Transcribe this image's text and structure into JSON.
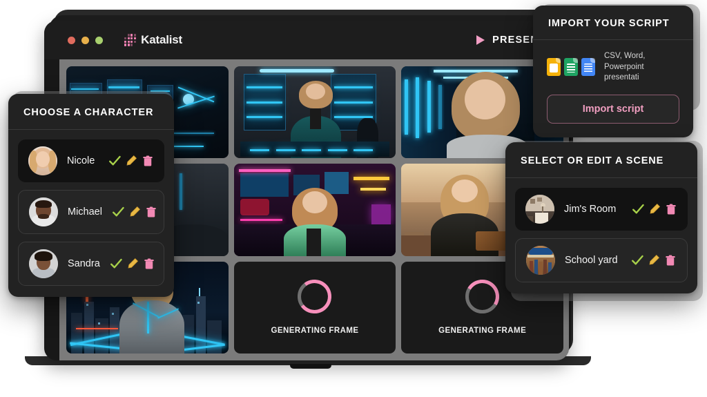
{
  "app": {
    "brand_name": "Katalist",
    "logo_icon": "katalist-dot-logo",
    "window_dots": [
      "#e06c5e",
      "#e8b04b",
      "#a8d06e"
    ],
    "present_label": "PRESENT",
    "present_icon": "play-triangle-icon"
  },
  "accent": {
    "pink": "#f29ec4",
    "pink_strong": "#f78fbb",
    "green_check": "#a8d14a",
    "yellow_pencil": "#e8b845",
    "trash_pink": "#f289b4",
    "panel_bg": "#222222",
    "row_selected_bg": "#121212",
    "screen_bg": "#7b7b7b"
  },
  "storyboard": {
    "cells": [
      {
        "id": "frame-1",
        "type": "image",
        "alt": "Tech lab with blue servers"
      },
      {
        "id": "frame-2",
        "type": "image",
        "alt": "Woman in teal suit at glowing store counter"
      },
      {
        "id": "frame-3",
        "type": "image",
        "alt": "Woman close-up in blue server corridor"
      },
      {
        "id": "frame-4",
        "type": "image",
        "alt": "Woman in dark suit side view"
      },
      {
        "id": "frame-5",
        "type": "image",
        "alt": "Woman in green jacket in neon club"
      },
      {
        "id": "frame-6",
        "type": "image",
        "alt": "Woman holding box over city rooftops at sunset"
      },
      {
        "id": "frame-7",
        "type": "image",
        "alt": "Woman in grey suit over neon night skyline"
      },
      {
        "id": "frame-8",
        "type": "generating",
        "label": "GENERATING FRAME"
      },
      {
        "id": "frame-9",
        "type": "generating",
        "label": "GENERATING FRAME"
      }
    ]
  },
  "import_panel": {
    "title": "IMPORT  YOUR SCRIPT",
    "formats_text": "CSV, Word, Powerpoint presentati",
    "file_icons": [
      {
        "name": "google-slides-icon",
        "color": "#f5b20a"
      },
      {
        "name": "google-sheets-icon",
        "color": "#1fa463"
      },
      {
        "name": "google-docs-icon",
        "color": "#4286f5"
      }
    ],
    "button_label": "Import script"
  },
  "character_panel": {
    "title": "CHOOSE A CHARACTER",
    "items": [
      {
        "label": "Nicole",
        "selected": true,
        "avatar": "avatar-nicole"
      },
      {
        "label": "Michael",
        "selected": false,
        "avatar": "avatar-michael"
      },
      {
        "label": "Sandra",
        "selected": false,
        "avatar": "avatar-sandra"
      }
    ],
    "actions": [
      "check-icon",
      "pencil-icon",
      "trash-icon"
    ]
  },
  "scene_panel": {
    "title": "SELECT OR EDIT A SCENE",
    "items": [
      {
        "label": "Jim's Room",
        "selected": true,
        "avatar": "scene-jims-room"
      },
      {
        "label": "School yard",
        "selected": false,
        "avatar": "scene-school-yard"
      }
    ],
    "actions": [
      "check-icon",
      "pencil-icon",
      "trash-icon"
    ]
  }
}
